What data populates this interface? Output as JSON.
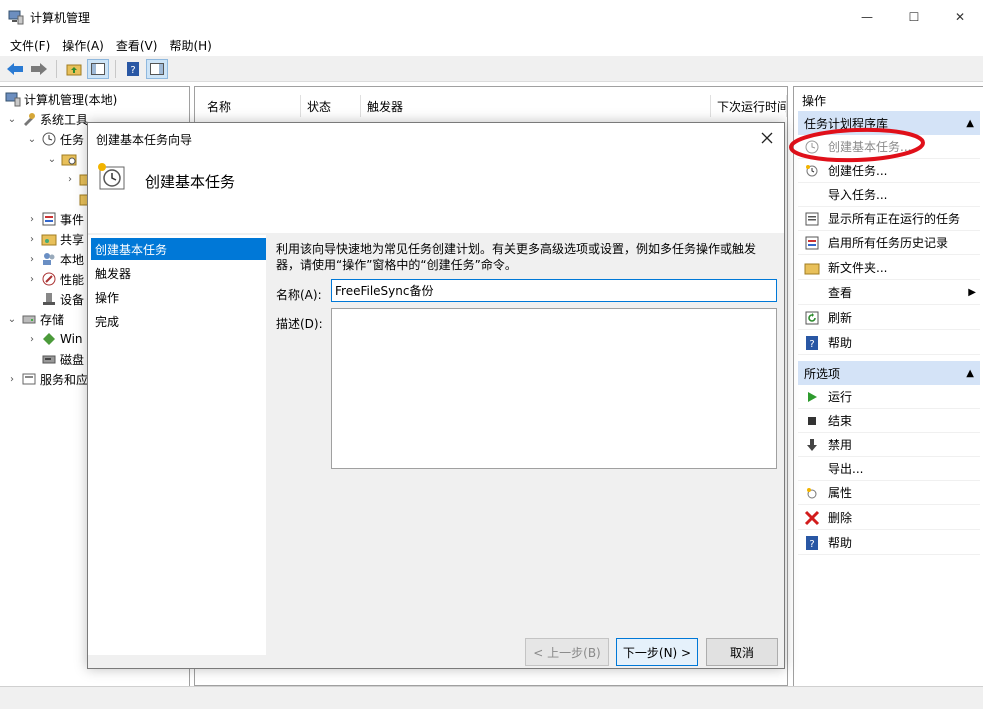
{
  "window": {
    "title": "计算机管理",
    "minimize": "—",
    "maximize": "☐",
    "close": "✕"
  },
  "menu": [
    "文件(F)",
    "操作(A)",
    "查看(V)",
    "帮助(H)"
  ],
  "tree": {
    "root": "计算机管理(本地)",
    "items": [
      {
        "label": "系统工具"
      },
      {
        "label": "任务"
      },
      {
        "label": "事件"
      },
      {
        "label": "共享"
      },
      {
        "label": "本地"
      },
      {
        "label": "性能"
      },
      {
        "label": "设备"
      },
      {
        "label": "存储"
      },
      {
        "label": "Win"
      },
      {
        "label": "磁盘"
      },
      {
        "label": "服务和应"
      }
    ]
  },
  "list": {
    "columns": [
      "名称",
      "状态",
      "触发器",
      "下次运行时间"
    ]
  },
  "actions": {
    "title": "操作",
    "section1": {
      "header": "任务计划程序库",
      "items": [
        {
          "label": "创建基本任务..."
        },
        {
          "label": "创建任务..."
        },
        {
          "label": "导入任务..."
        },
        {
          "label": "显示所有正在运行的任务"
        },
        {
          "label": "启用所有任务历史记录"
        },
        {
          "label": "新文件夹..."
        },
        {
          "label": "查看"
        },
        {
          "label": "刷新"
        },
        {
          "label": "帮助"
        }
      ]
    },
    "section2": {
      "header": "所选项",
      "items": [
        {
          "label": "运行"
        },
        {
          "label": "结束"
        },
        {
          "label": "禁用"
        },
        {
          "label": "导出..."
        },
        {
          "label": "属性"
        },
        {
          "label": "删除"
        },
        {
          "label": "帮助"
        }
      ]
    }
  },
  "wizard": {
    "title": "创建基本任务向导",
    "heading": "创建基本任务",
    "steps": [
      "创建基本任务",
      "触发器",
      "操作",
      "完成"
    ],
    "description": "利用该向导快速地为常见任务创建计划。有关更多高级选项或设置，例如多任务操作或触发器，请使用“操作”窗格中的“创建任务”命令。",
    "name_label": "名称(A):",
    "name_value": "FreeFileSync备份",
    "desc_label": "描述(D):",
    "desc_value": "",
    "buttons": {
      "back": "< 上一步(B)",
      "next": "下一步(N) >",
      "cancel": "取消"
    }
  },
  "colors": {
    "accent": "#0078d7",
    "section_header": "#d4e3f7",
    "highlight_circle": "#e0101a"
  }
}
